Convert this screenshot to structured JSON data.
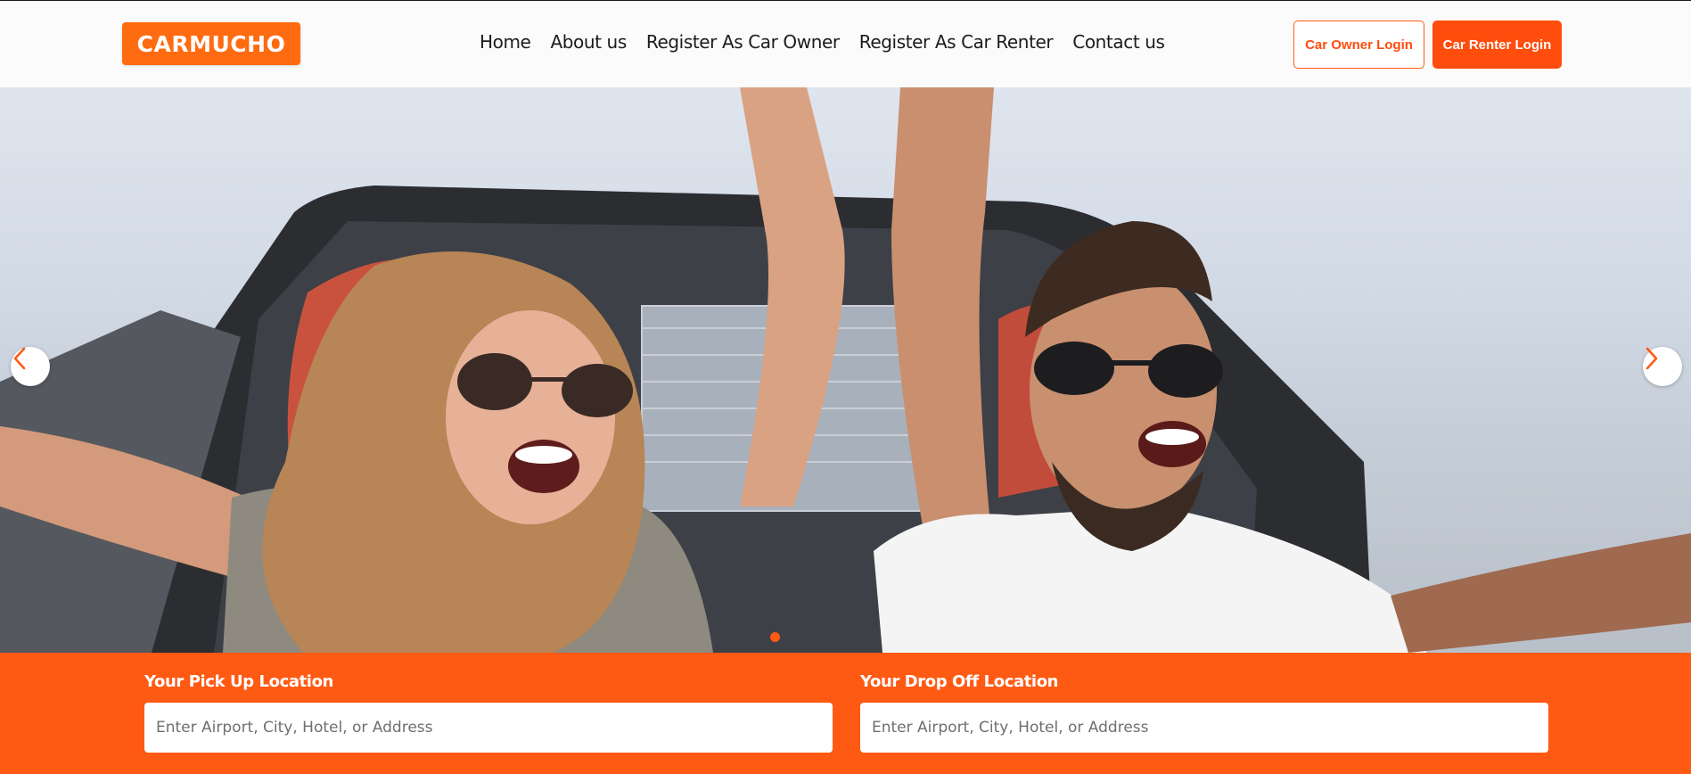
{
  "brand": {
    "logo_text": "CARMUCHO",
    "accent_color": "#ff5a14"
  },
  "nav": {
    "items": [
      {
        "label": "Home"
      },
      {
        "label": "About us"
      },
      {
        "label": "Register As Car Owner"
      },
      {
        "label": "Register As Car Renter"
      },
      {
        "label": "Contact us"
      }
    ]
  },
  "auth": {
    "owner_login_label": "Car Owner Login",
    "renter_login_label": "Car Renter Login"
  },
  "hero": {
    "prev_icon": "chevron-left-icon",
    "next_icon": "chevron-right-icon",
    "slide_count_visible": 1,
    "active_slide": 1
  },
  "search": {
    "pickup": {
      "label": "Your Pick Up Location",
      "placeholder": "Enter Airport, City, Hotel, or Address",
      "value": ""
    },
    "dropoff": {
      "label": "Your Drop Off Location",
      "placeholder": "Enter Airport, City, Hotel, or Address",
      "value": ""
    }
  }
}
